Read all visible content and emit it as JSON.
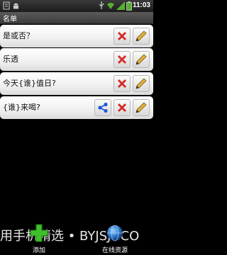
{
  "status_bar": {
    "time": "11:03"
  },
  "title": "名单",
  "rows": [
    {
      "label": "是或否？",
      "has_share": false
    },
    {
      "label": "乐透",
      "has_share": false
    },
    {
      "label": "今天{谁}值日?",
      "has_share": false
    },
    {
      "label": "{谁}来喝?",
      "has_share": true
    }
  ],
  "bottom_text": "用手机精选 • BYJSJY.CO",
  "bottom_bar": {
    "add_label": "添加",
    "online_label": "在线资源"
  },
  "colors": {
    "delete_red": "#d62a2a",
    "share_blue": "#1b5bd6",
    "pencil": "#c98a1a"
  }
}
